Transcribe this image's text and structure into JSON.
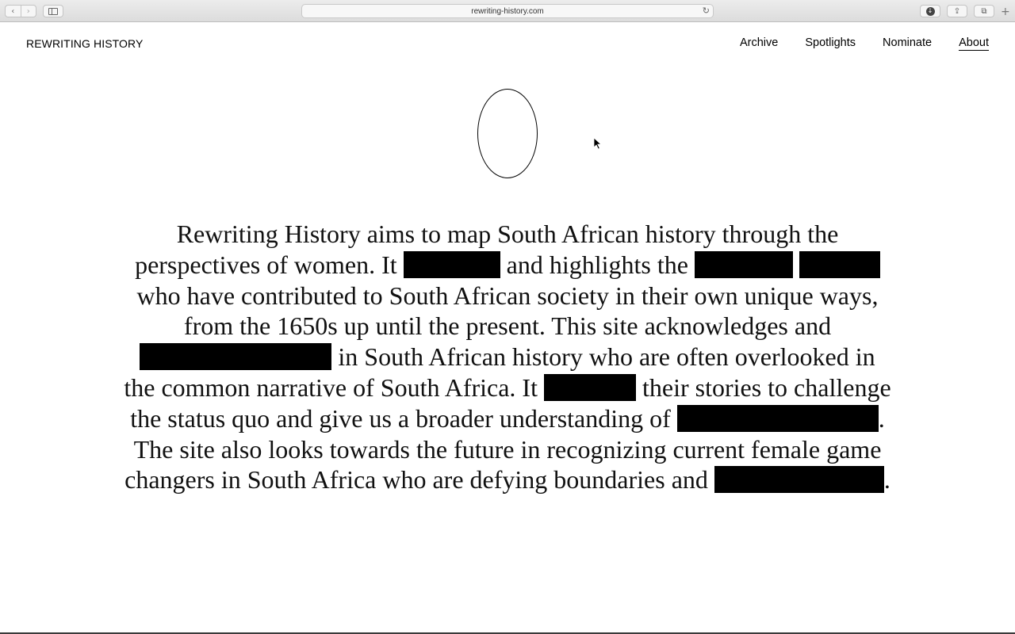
{
  "browser": {
    "url": "rewriting-history.com",
    "back_glyph": "‹",
    "forward_glyph": "›",
    "reload_glyph": "↻",
    "download_glyph": "↓",
    "share_glyph": "⇪",
    "tabs_glyph": "⧉",
    "newtab_glyph": "+"
  },
  "site": {
    "title": "REWRITING HISTORY",
    "nav": {
      "archive": "Archive",
      "spotlights": "Spotlights",
      "nominate": "Nominate",
      "about": "About"
    },
    "active_nav": "About"
  },
  "intro": {
    "s1": "Rewriting History aims to map South African history through the perspectives of women. It",
    "s2": "and highlights the",
    "s3": "who have contributed to South African society in their own unique ways, from the 1650s up until the present. This site acknowledges and",
    "s4": "in South African history who are often overlooked in the common narrative of South Africa. It",
    "s5": "their stories to challenge the status quo and give us a broader understanding of",
    "s6": ". The site also looks towards the future in recognizing current female game changers in South Africa who are defying boundaries and",
    "s7": "."
  },
  "colors": {
    "background": "#ffffff",
    "text": "#111111",
    "redaction": "#000000"
  }
}
